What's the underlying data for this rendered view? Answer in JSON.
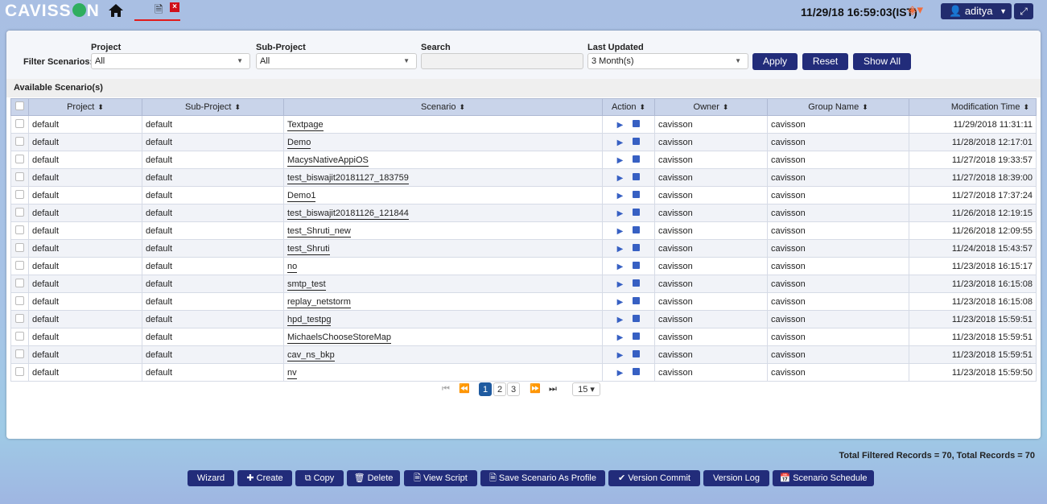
{
  "header": {
    "logo": "CAVISSON",
    "datetime": "11/29/18 16:59:03(IST)",
    "user": "aditya"
  },
  "filter": {
    "label": "Filter Scenarios:",
    "project_label": "Project",
    "project_value": "All",
    "subproject_label": "Sub-Project",
    "subproject_value": "All",
    "search_label": "Search",
    "search_value": "",
    "updated_label": "Last Updated",
    "updated_value": "3 Month(s)",
    "apply": "Apply",
    "reset": "Reset",
    "show_all": "Show All"
  },
  "available_title": "Available Scenario(s)",
  "columns": [
    "Project",
    "Sub-Project",
    "Scenario",
    "Action",
    "Owner",
    "Group Name",
    "Modification Time"
  ],
  "rows": [
    [
      "default",
      "default",
      "Textpage",
      "cavisson",
      "cavisson",
      "11/29/2018 11:31:11"
    ],
    [
      "default",
      "default",
      "Demo",
      "cavisson",
      "cavisson",
      "11/28/2018 12:17:01"
    ],
    [
      "default",
      "default",
      "MacysNativeAppiOS",
      "cavisson",
      "cavisson",
      "11/27/2018 19:33:57"
    ],
    [
      "default",
      "default",
      "test_biswajit20181127_183759",
      "cavisson",
      "cavisson",
      "11/27/2018 18:39:00"
    ],
    [
      "default",
      "default",
      "Demo1",
      "cavisson",
      "cavisson",
      "11/27/2018 17:37:24"
    ],
    [
      "default",
      "default",
      "test_biswajit20181126_121844",
      "cavisson",
      "cavisson",
      "11/26/2018 12:19:15"
    ],
    [
      "default",
      "default",
      "test_Shruti_new",
      "cavisson",
      "cavisson",
      "11/26/2018 12:09:55"
    ],
    [
      "default",
      "default",
      "test_Shruti",
      "cavisson",
      "cavisson",
      "11/24/2018 15:43:57"
    ],
    [
      "default",
      "default",
      "no",
      "cavisson",
      "cavisson",
      "11/23/2018 16:15:17"
    ],
    [
      "default",
      "default",
      "smtp_test",
      "cavisson",
      "cavisson",
      "11/23/2018 16:15:08"
    ],
    [
      "default",
      "default",
      "replay_netstorm",
      "cavisson",
      "cavisson",
      "11/23/2018 16:15:08"
    ],
    [
      "default",
      "default",
      "hpd_testpg",
      "cavisson",
      "cavisson",
      "11/23/2018 15:59:51"
    ],
    [
      "default",
      "default",
      "MichaelsChooseStoreMap",
      "cavisson",
      "cavisson",
      "11/23/2018 15:59:51"
    ],
    [
      "default",
      "default",
      "cav_ns_bkp",
      "cavisson",
      "cavisson",
      "11/23/2018 15:59:51"
    ],
    [
      "default",
      "default",
      "nv",
      "cavisson",
      "cavisson",
      "11/23/2018 15:59:50"
    ]
  ],
  "pager": {
    "pages": [
      "1",
      "2",
      "3"
    ],
    "current": "1",
    "page_size": "15"
  },
  "totals": "Total Filtered Records = 70, Total Records = 70",
  "buttons": {
    "wizard": "Wizard",
    "create": "Create",
    "copy": "Copy",
    "delete": "Delete",
    "view_script": "View Script",
    "save_profile": "Save Scenario As Profile",
    "version_commit": "Version Commit",
    "version_log": "Version Log",
    "schedule": "Scenario Schedule"
  },
  "colors": {
    "accent": "#222c7a",
    "header_bg": "#c9d4ea"
  }
}
